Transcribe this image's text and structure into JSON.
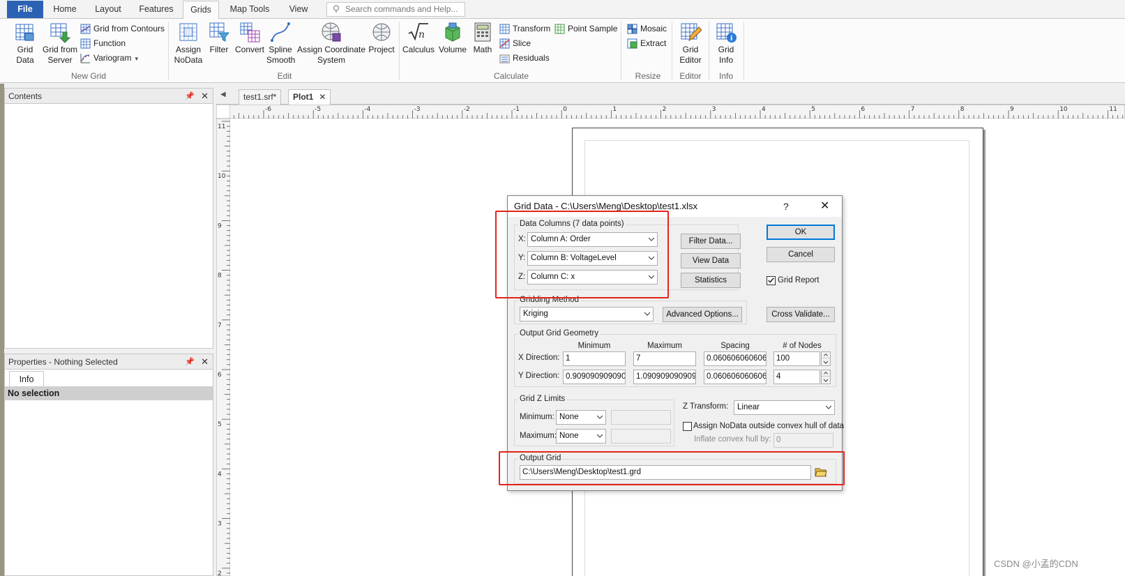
{
  "ribbon": {
    "tabs": [
      {
        "label": "File"
      },
      {
        "label": "Home"
      },
      {
        "label": "Layout"
      },
      {
        "label": "Features"
      },
      {
        "label": "Grids"
      },
      {
        "label": "Map Tools"
      },
      {
        "label": "View"
      }
    ],
    "search_placeholder": "Search commands and Help...",
    "groups": {
      "new_grid": {
        "label": "New Grid",
        "grid_data": [
          "Grid",
          "Data"
        ],
        "grid_from_server": [
          "Grid from",
          "Server"
        ],
        "grid_from_contours": "Grid from Contours",
        "function": "Function",
        "variogram": "Variogram"
      },
      "edit": {
        "label": "Edit",
        "assign_nodata": [
          "Assign",
          "NoData"
        ],
        "filter": "Filter",
        "convert": "Convert",
        "spline_smooth": [
          "Spline",
          "Smooth"
        ],
        "assign_coordinate_system": [
          "Assign Coordinate",
          "System"
        ],
        "project": "Project"
      },
      "calculate": {
        "label": "Calculate",
        "calculus": "Calculus",
        "volume": "Volume",
        "math": "Math",
        "transform": "Transform",
        "slice": "Slice",
        "residuals": "Residuals",
        "point_sample": "Point Sample"
      },
      "resize": {
        "label": "Resize",
        "mosaic": "Mosaic",
        "extract": "Extract"
      },
      "editor": {
        "label": "Editor",
        "grid_editor": [
          "Grid",
          "Editor"
        ]
      },
      "info": {
        "label": "Info",
        "grid_info": [
          "Grid",
          "Info"
        ]
      }
    }
  },
  "panes": {
    "contents": {
      "title": "Contents"
    },
    "properties": {
      "title": "Properties - Nothing Selected",
      "tab": "Info",
      "no_selection": "No selection"
    }
  },
  "doc_tabs": [
    {
      "label": "test1.srf*"
    },
    {
      "label": "Plot1"
    }
  ],
  "rulers": {
    "horizontal": [
      "-6",
      "-5",
      "-4",
      "-3",
      "-2",
      "-1",
      "0",
      "1",
      "2",
      "3",
      "4",
      "5",
      "6",
      "7",
      "8",
      "9",
      "10",
      "11"
    ],
    "vertical": [
      "11",
      "10",
      "9",
      "8",
      "7",
      "6",
      "5",
      "4",
      "3",
      "2"
    ]
  },
  "dialog": {
    "title": "Grid Data - C:\\Users\\Meng\\Desktop\\test1.xlsx",
    "help": "?",
    "data_columns": {
      "legend": "Data Columns    (7 data points)",
      "x_label": "X:",
      "x_value": "Column A:  Order",
      "y_label": "Y:",
      "y_value": "Column B:  VoltageLevel",
      "z_label": "Z:",
      "z_value": "Column C:  x"
    },
    "buttons": {
      "filter_data": "Filter Data...",
      "view_data": "View Data",
      "statistics": "Statistics",
      "ok": "OK",
      "cancel": "Cancel",
      "advanced_options": "Advanced Options...",
      "cross_validate": "Cross Validate..."
    },
    "grid_report": {
      "label": "Grid Report",
      "checked": true
    },
    "gridding_method": {
      "legend": "Gridding Method",
      "value": "Kriging"
    },
    "output_geometry": {
      "legend": "Output Grid Geometry",
      "columns": [
        "Minimum",
        "Maximum",
        "Spacing",
        "# of Nodes"
      ],
      "x": {
        "label": "X Direction:",
        "min": "1",
        "max": "7",
        "spacing": "0.0606060606060",
        "nodes": "100"
      },
      "y": {
        "label": "Y Direction:",
        "min": "0.9090909090909",
        "max": "1.0909090909090",
        "spacing": "0.0606060606060",
        "nodes": "4"
      }
    },
    "z_limits": {
      "legend": "Grid Z Limits",
      "minimum_label": "Minimum:",
      "minimum_value": "None",
      "maximum_label": "Maximum:",
      "maximum_value": "None"
    },
    "z_transform": {
      "label": "Z Transform:",
      "value": "Linear"
    },
    "assign_nodata": {
      "label": "Assign NoData outside convex hull of data",
      "checked": false
    },
    "inflate": {
      "label": "Inflate convex hull by:",
      "value": "0"
    },
    "output_grid": {
      "legend": "Output Grid",
      "path": "C:\\Users\\Meng\\Desktop\\test1.grd"
    }
  },
  "watermark": "CSDN @小孟的CDN",
  "colors": {
    "file_tab": "#2b62b4",
    "highlight": "#e5231b",
    "ok_border": "#0078d7"
  }
}
